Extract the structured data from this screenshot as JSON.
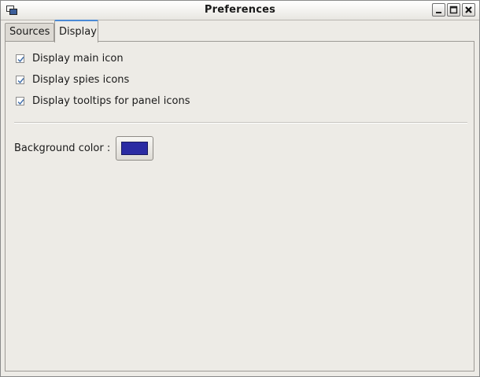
{
  "window": {
    "title": "Preferences"
  },
  "tabs": [
    {
      "label": "Sources",
      "active": false
    },
    {
      "label": "Display",
      "active": true
    }
  ],
  "display": {
    "checkboxes": [
      {
        "label": "Display main icon",
        "checked": true
      },
      {
        "label": "Display spies icons",
        "checked": true
      },
      {
        "label": "Display tooltips for panel icons",
        "checked": true
      }
    ],
    "background_label": "Background color :",
    "background_color": "#2b2ba3"
  },
  "icons": {
    "app": "window-app-icon",
    "minimize": "minimize-icon",
    "maximize": "maximize-icon",
    "close": "close-icon",
    "check": "checkmark-icon"
  }
}
